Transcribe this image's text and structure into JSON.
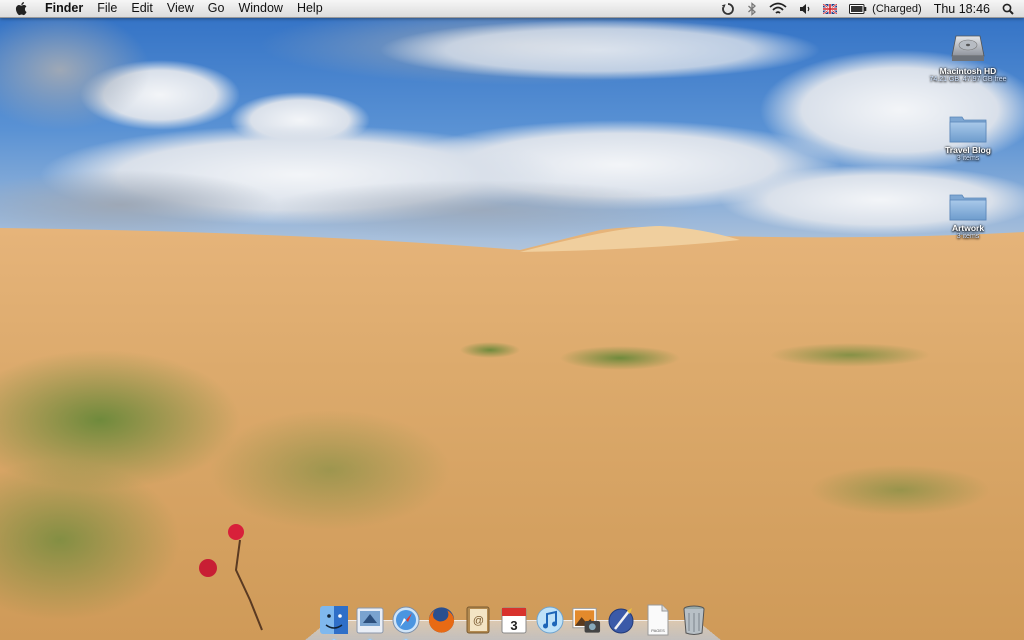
{
  "menubar": {
    "apple_menu": "apple-icon",
    "app_name": "Finder",
    "menus": [
      "File",
      "Edit",
      "View",
      "Go",
      "Window",
      "Help"
    ],
    "status": {
      "sync_icon": "sync-icon",
      "bluetooth_icon": "bluetooth-icon",
      "wifi_icon": "wifi-icon",
      "volume_icon": "volume-icon",
      "input_flag_icon": "uk-flag-icon",
      "battery_icon": "battery-icon",
      "battery_text": "(Charged)",
      "clock": "Thu 18:46",
      "spotlight_icon": "spotlight-icon"
    }
  },
  "desktop_icons": [
    {
      "name": "Macintosh HD",
      "sub": "74.21 GB, 47.97 GB free",
      "icon": "hard-drive-icon"
    },
    {
      "name": "Travel Blog",
      "sub": "3 items",
      "icon": "folder-icon"
    },
    {
      "name": "Artwork",
      "sub": "3 items",
      "icon": "folder-icon"
    }
  ],
  "dock": {
    "items": [
      {
        "icon": "finder-icon",
        "running": true
      },
      {
        "icon": "mail-icon",
        "running": true
      },
      {
        "icon": "safari-icon",
        "running": true
      },
      {
        "icon": "firefox-icon",
        "running": false
      },
      {
        "icon": "address-book-icon",
        "running": false
      },
      {
        "icon": "ical-icon",
        "running": false,
        "text": "3"
      },
      {
        "icon": "itunes-icon",
        "running": false
      },
      {
        "icon": "iphoto-icon",
        "running": false
      },
      {
        "icon": "preview-icon",
        "running": false
      },
      {
        "icon": "pages-document-icon",
        "running": false,
        "text": "PAGES"
      },
      {
        "icon": "trash-icon",
        "running": false
      }
    ]
  },
  "colors": {
    "sky": "#4f8bd0",
    "sand": "#d9a766",
    "grass": "#7c8a3a",
    "menu_bar": "#e6e6e6"
  }
}
